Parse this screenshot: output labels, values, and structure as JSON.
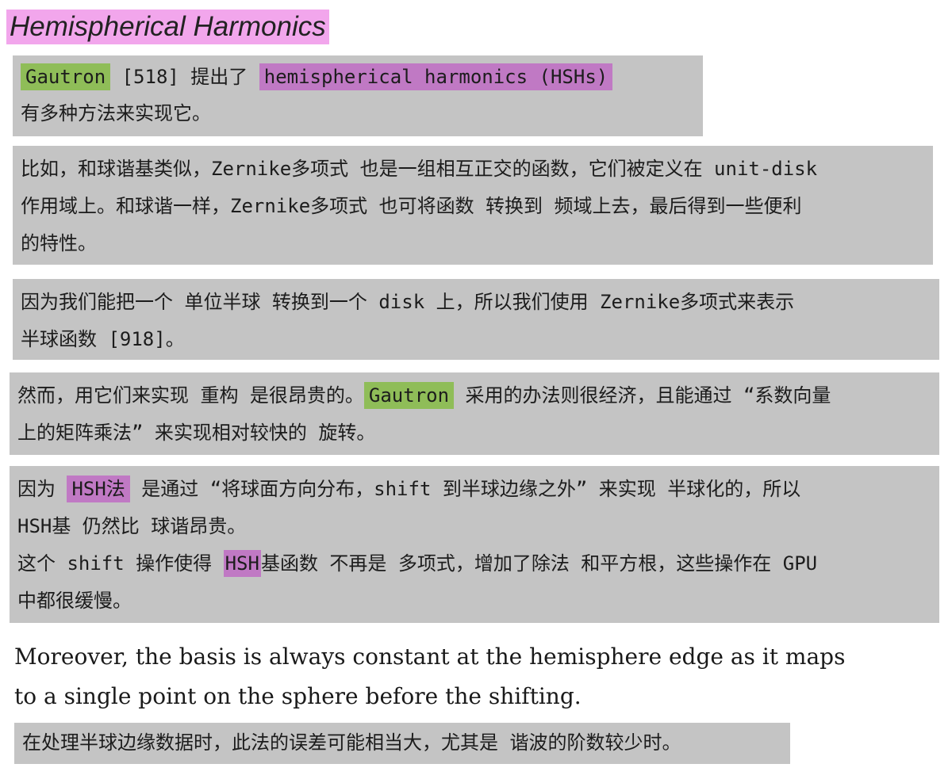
{
  "title": "Hemispherical Harmonics",
  "block1": {
    "line1": {
      "gautron": "Gautron",
      "ref": " [518] 提出了 ",
      "hsh": "hemispherical harmonics (HSHs)"
    },
    "line2": "有多种方法来实现它。"
  },
  "block2": {
    "line1": "比如，和球谐基类似，Zernike多项式 也是一组相互正交的函数，它们被定义在 unit-disk",
    "line2": "作用域上。和球谐一样，Zernike多项式 也可将函数 转换到 频域上去，最后得到一些便利",
    "line3": "的特性。"
  },
  "block3": {
    "line1": "因为我们能把一个 单位半球 转换到一个 disk 上，所以我们使用 Zernike多项式来表示",
    "line2": "半球函数 [918]。"
  },
  "block4": {
    "line1_pre": "然而，用它们来实现 重构 是很昂贵的。",
    "gautron": "Gautron",
    "line1_post": " 采用的办法则很经济，且能通过 “系数向量",
    "line2": "上的矩阵乘法” 来实现相对较快的 旋转。"
  },
  "block5": {
    "line1_pre": "因为 ",
    "hsh_method": "HSH法",
    "line1_post": " 是通过 “将球面方向分布，shift 到半球边缘之外” 来实现 半球化的，所以",
    "line2": "HSH基 仍然比 球谐昂贵。",
    "line3_pre": "这个 shift 操作使得 ",
    "hsh": "HSH",
    "line3_post": "基函数 不再是 多项式，增加了除法 和平方根，这些操作在 GPU",
    "line4": "中都很缓慢。"
  },
  "english": {
    "line1": "Moreover, the basis is always constant at the hemisphere edge as it maps",
    "line2": "to a single point on the sphere before the shifting."
  },
  "block6": {
    "line1": "在处理半球边缘数据时，此法的误差可能相当大，尤其是 谐波的阶数较少时。"
  },
  "colors": {
    "title_highlight": "#f2a6ec",
    "note_background": "#c4c4c4",
    "green_highlight": "#8fbd58",
    "purple_highlight": "#c079c4"
  }
}
